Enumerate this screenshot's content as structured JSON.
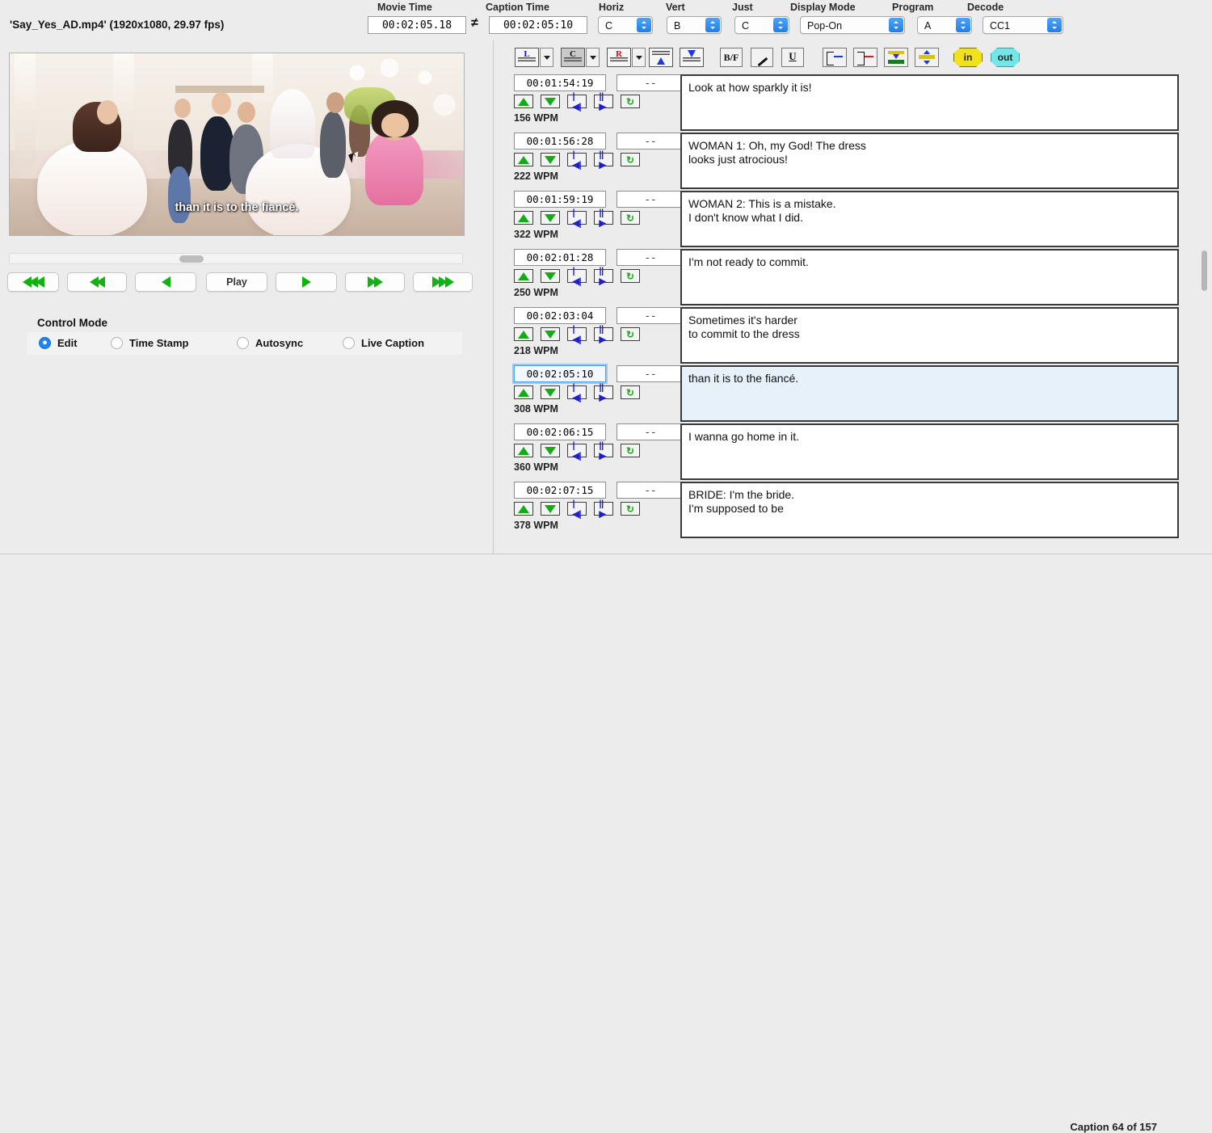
{
  "app": {
    "file_label": "'Say_Yes_AD.mp4'  (1920x1080, 29.97 fps)",
    "status": "Caption 64 of 157"
  },
  "header": {
    "movie_time_label": "Movie Time",
    "movie_time_value": "00:02:05.18",
    "not_equal_glyph": "≠",
    "caption_time_label": "Caption Time",
    "caption_time_value": "00:02:05:10",
    "horiz_label": "Horiz",
    "horiz_value": "C",
    "vert_label": "Vert",
    "vert_value": "B",
    "just_label": "Just",
    "just_value": "C",
    "display_mode_label": "Display Mode",
    "display_mode_value": "Pop-On",
    "program_label": "Program",
    "program_value": "A",
    "decode_label": "Decode",
    "decode_value": "CC1"
  },
  "toolbar": {
    "align_left": "L",
    "align_center": "C",
    "align_right": "R",
    "bf_label": "B/F",
    "italic_label": "I",
    "underline_label": "U",
    "in_label": "in",
    "out_label": "out",
    "in_color": "#f2e21c",
    "out_color": "#74e6e8"
  },
  "video": {
    "subtitle": "than it is to the fiancé."
  },
  "transport": {
    "play_label": "Play",
    "buttons": [
      "rew3",
      "rew2",
      "rew1",
      "Play",
      "fwd1",
      "fwd2",
      "fwd3"
    ]
  },
  "control_mode": {
    "title": "Control Mode",
    "options": [
      {
        "label": "Edit",
        "selected": true
      },
      {
        "label": "Time Stamp",
        "selected": false
      },
      {
        "label": "Autosync",
        "selected": false
      },
      {
        "label": "Live Caption",
        "selected": false
      }
    ]
  },
  "captions": {
    "dash_placeholder": "--",
    "rows": [
      {
        "timecode": "00:01:54:19",
        "dash": "--",
        "wpm": "156 WPM",
        "text": "Look at how sparkly it is!",
        "selected": false
      },
      {
        "timecode": "00:01:56:28",
        "dash": "--",
        "wpm": "222 WPM",
        "text": "WOMAN 1: Oh, my God! The dress\nlooks just atrocious!",
        "selected": false
      },
      {
        "timecode": "00:01:59:19",
        "dash": "--",
        "wpm": "322 WPM",
        "text": "WOMAN 2: This is a mistake.\nI don't know what I did.",
        "selected": false
      },
      {
        "timecode": "00:02:01:28",
        "dash": "--",
        "wpm": "250 WPM",
        "text": "I'm not ready to commit.",
        "selected": false
      },
      {
        "timecode": "00:02:03:04",
        "dash": "--",
        "wpm": "218 WPM",
        "text": "Sometimes it's harder\nto commit to the dress",
        "selected": false
      },
      {
        "timecode": "00:02:05:10",
        "dash": "--",
        "wpm": "308 WPM",
        "text": "than it is to the fiancé.",
        "selected": true
      },
      {
        "timecode": "00:02:06:15",
        "dash": "--",
        "wpm": "360 WPM",
        "text": "I wanna go home in it.",
        "selected": false
      },
      {
        "timecode": "00:02:07:15",
        "dash": "--",
        "wpm": "378 WPM",
        "text": "BRIDE: I'm the bride.\nI'm supposed to be",
        "selected": false
      }
    ]
  }
}
